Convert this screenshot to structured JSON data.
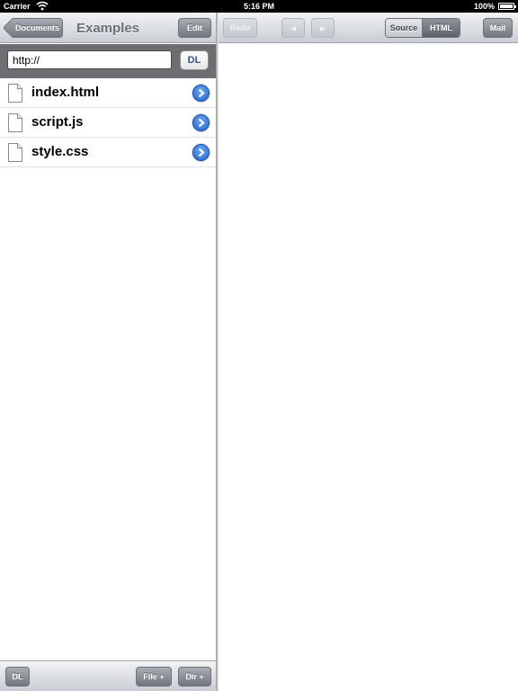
{
  "status_bar": {
    "carrier": "Carrier",
    "time": "5:16 PM",
    "battery": "100%"
  },
  "left_pane": {
    "nav": {
      "back_label": "Documents",
      "title": "Examples",
      "edit_label": "Edit"
    },
    "url_bar": {
      "value": "http://",
      "dl_label": "DL"
    },
    "files": [
      {
        "name": "index.html",
        "icon": "file-icon"
      },
      {
        "name": "script.js",
        "icon": "file-icon"
      },
      {
        "name": "style.css",
        "icon": "file-icon"
      }
    ],
    "toolbar": {
      "dl_label": "DL",
      "file_label": "File +",
      "dir_label": "Dir +"
    }
  },
  "right_pane": {
    "toolbar": {
      "redo_label": "Redo",
      "prev_icon": "arrow-left-icon",
      "next_icon": "arrow-right-icon",
      "segments": [
        "Source",
        "HTML"
      ],
      "selected_segment": "HTML",
      "mail_label": "Mail"
    }
  },
  "colors": {
    "accent_blue": "#1f64d3",
    "toolbar_button": "#71757d",
    "url_bar_bg": "#6d6d72"
  }
}
